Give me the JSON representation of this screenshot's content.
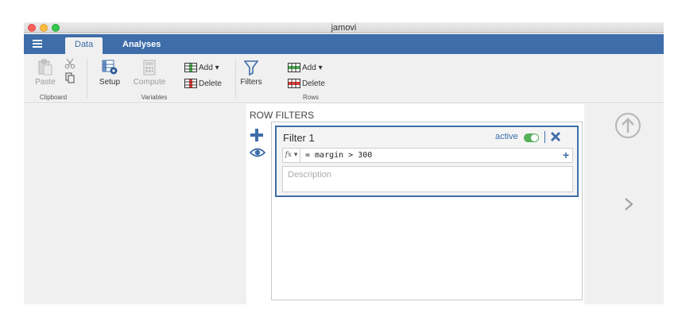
{
  "window": {
    "title": "jamovi"
  },
  "tabs": [
    {
      "label": "Data",
      "active": true
    },
    {
      "label": "Analyses",
      "active": false
    }
  ],
  "ribbon": {
    "clipboard": {
      "paste_label": "Paste",
      "group_label": "Clipboard"
    },
    "variables": {
      "setup_label": "Setup",
      "compute_label": "Compute",
      "add_label": "Add ▾",
      "delete_label": "Delete",
      "group_label": "Variables"
    },
    "rows": {
      "filters_label": "Filters",
      "add_label": "Add ▾",
      "delete_label": "Delete",
      "group_label": "Rows"
    }
  },
  "row_filters": {
    "title": "ROW FILTERS",
    "filters": [
      {
        "name": "Filter 1",
        "status": "active",
        "fx_label": "fx ▾",
        "formula": "= margin > 300",
        "description_placeholder": "Description"
      }
    ]
  },
  "icons": {
    "accent": "#3e6da9",
    "toggle_on": "#56b05a",
    "tabbar": "#3e6da9"
  }
}
